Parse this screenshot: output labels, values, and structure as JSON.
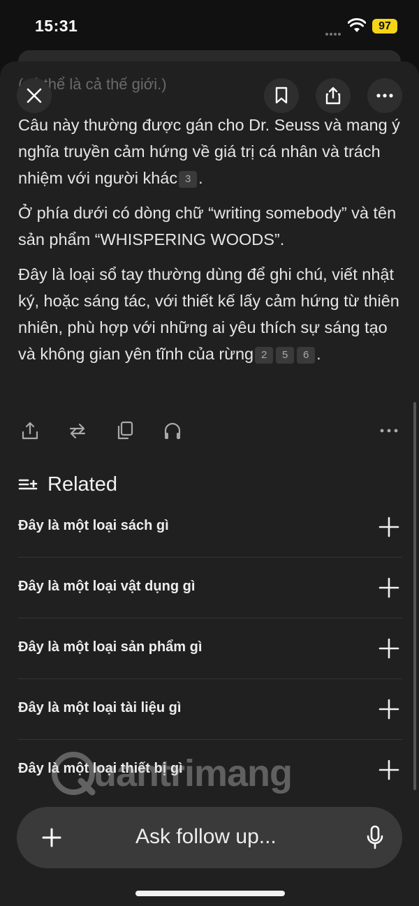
{
  "status_bar": {
    "time": "15:31",
    "battery": "97"
  },
  "header": {
    "faded_text": "(có thể là cả thế giới.)"
  },
  "answer": {
    "paragraphs": [
      {
        "text": "Câu này thường được gán cho Dr. Seuss và mang ý nghĩa truyền cảm hứng về giá trị cá nhân và trách nhiệm với người khác",
        "citations": [
          "3"
        ],
        "end": "."
      },
      {
        "text": "Ở phía dưới có dòng chữ “writing somebody” và tên sản phẩm “WHISPERING WOODS”.",
        "citations": [],
        "end": ""
      },
      {
        "text": "Đây là loại sổ tay thường dùng để ghi chú, viết nhật ký, hoặc sáng tác, với thiết kế lấy cảm hứng từ thiên nhiên, phù hợp với những ai yêu thích sự sáng tạo và không gian yên tĩnh của rừng",
        "citations": [
          "2",
          "5",
          "6"
        ],
        "end": "."
      }
    ]
  },
  "related": {
    "title": "Related",
    "items": [
      "Đây là một loại sách gì",
      "Đây là một loại vật dụng gì",
      "Đây là một loại sản phẩm gì",
      "Đây là một loại tài liệu gì",
      "Đây là một loại thiết bị gì"
    ]
  },
  "ask_bar": {
    "placeholder": "Ask follow up..."
  },
  "watermark": {
    "text": "uantrimang"
  },
  "colors": {
    "background": "#111111",
    "sheet": "#202020",
    "ask_bar": "#3a3a3a",
    "battery": "#f5d516"
  },
  "icons": [
    "close-icon",
    "bookmark-icon",
    "share-icon",
    "more-icon",
    "upload-icon",
    "rewrite-icon",
    "copy-icon",
    "headphones-icon",
    "related-list-icon",
    "plus-icon",
    "microphone-icon",
    "wifi-icon"
  ]
}
